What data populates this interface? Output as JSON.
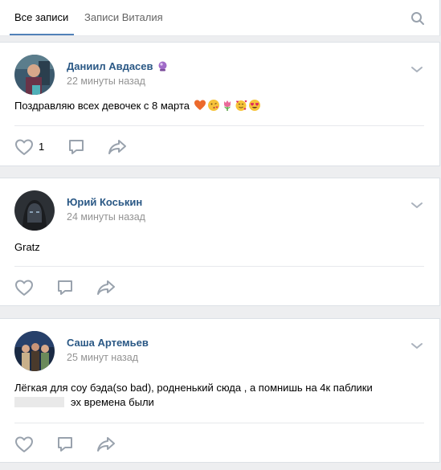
{
  "tabs": {
    "all_posts": "Все записи",
    "user_posts": "Записи Виталия",
    "search_icon": "search-icon"
  },
  "colors": {
    "link": "#2a5885",
    "meta": "#939393",
    "icon": "#99a2ad",
    "tab_underline": "#5181b8",
    "background": "#edeef0"
  },
  "posts": [
    {
      "author": "Даниил Авдасев",
      "author_emblem": "crystal-ball-icon",
      "time": "22 минуты назад",
      "text": "Поздравляю всех девочек с 8 марта",
      "emojis": [
        "heart-emoji",
        "kiss-emoji",
        "tulip-emoji",
        "smiling-hearts-emoji",
        "heart-eyes-emoji"
      ],
      "likes": "1"
    },
    {
      "author": "Юрий Коськин",
      "time": "24 минуты назад",
      "text": "Gratz",
      "likes": ""
    },
    {
      "author": "Саша Артемьев",
      "time": "25 минут назад",
      "text_line1": "Лёгкая для соу бэда(so bad), родненький сюда , а помнишь на 4к паблики",
      "text_line2": "эх времена были",
      "likes": ""
    }
  ]
}
